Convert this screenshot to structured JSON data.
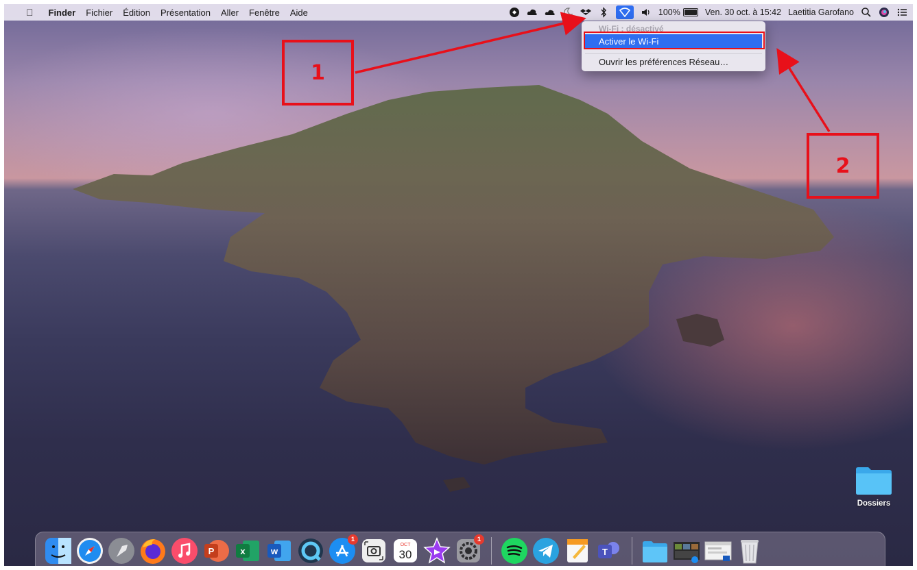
{
  "menubar": {
    "app_name": "Finder",
    "menus": [
      "Fichier",
      "Édition",
      "Présentation",
      "Aller",
      "Fenêtre",
      "Aide"
    ],
    "battery_percent": "100%",
    "datetime": "Ven. 30 oct. à 15:42",
    "user": "Laetitia Garofano"
  },
  "wifi_menu": {
    "status": "Wi-Fi : désactivé",
    "enable_label": "Activer le Wi-Fi",
    "prefs_label": "Ouvrir les préférences Réseau…"
  },
  "annotations": {
    "step1": "1",
    "step2": "2"
  },
  "desktop": {
    "folder_label": "Dossiers"
  },
  "dock": {
    "calendar_month": "OCT",
    "calendar_day": "30",
    "appstore_badge": "1",
    "settings_badge": "1",
    "items": [
      "finder-icon",
      "safari-icon",
      "launchpad-icon",
      "firefox-icon",
      "music-icon",
      "powerpoint-icon",
      "excel-icon",
      "word-icon",
      "quicktime-icon",
      "appstore-icon",
      "screenshot-icon",
      "calendar-icon",
      "imovie-icon",
      "system-preferences-icon",
      "spotify-icon",
      "telegram-icon",
      "pages-icon",
      "teams-icon",
      "downloads-folder-icon",
      "window-thumb-icon",
      "window-thumb-2-icon",
      "trash-icon"
    ]
  },
  "colors": {
    "accent": "#2f6ef0",
    "annotation": "#e8101a"
  }
}
